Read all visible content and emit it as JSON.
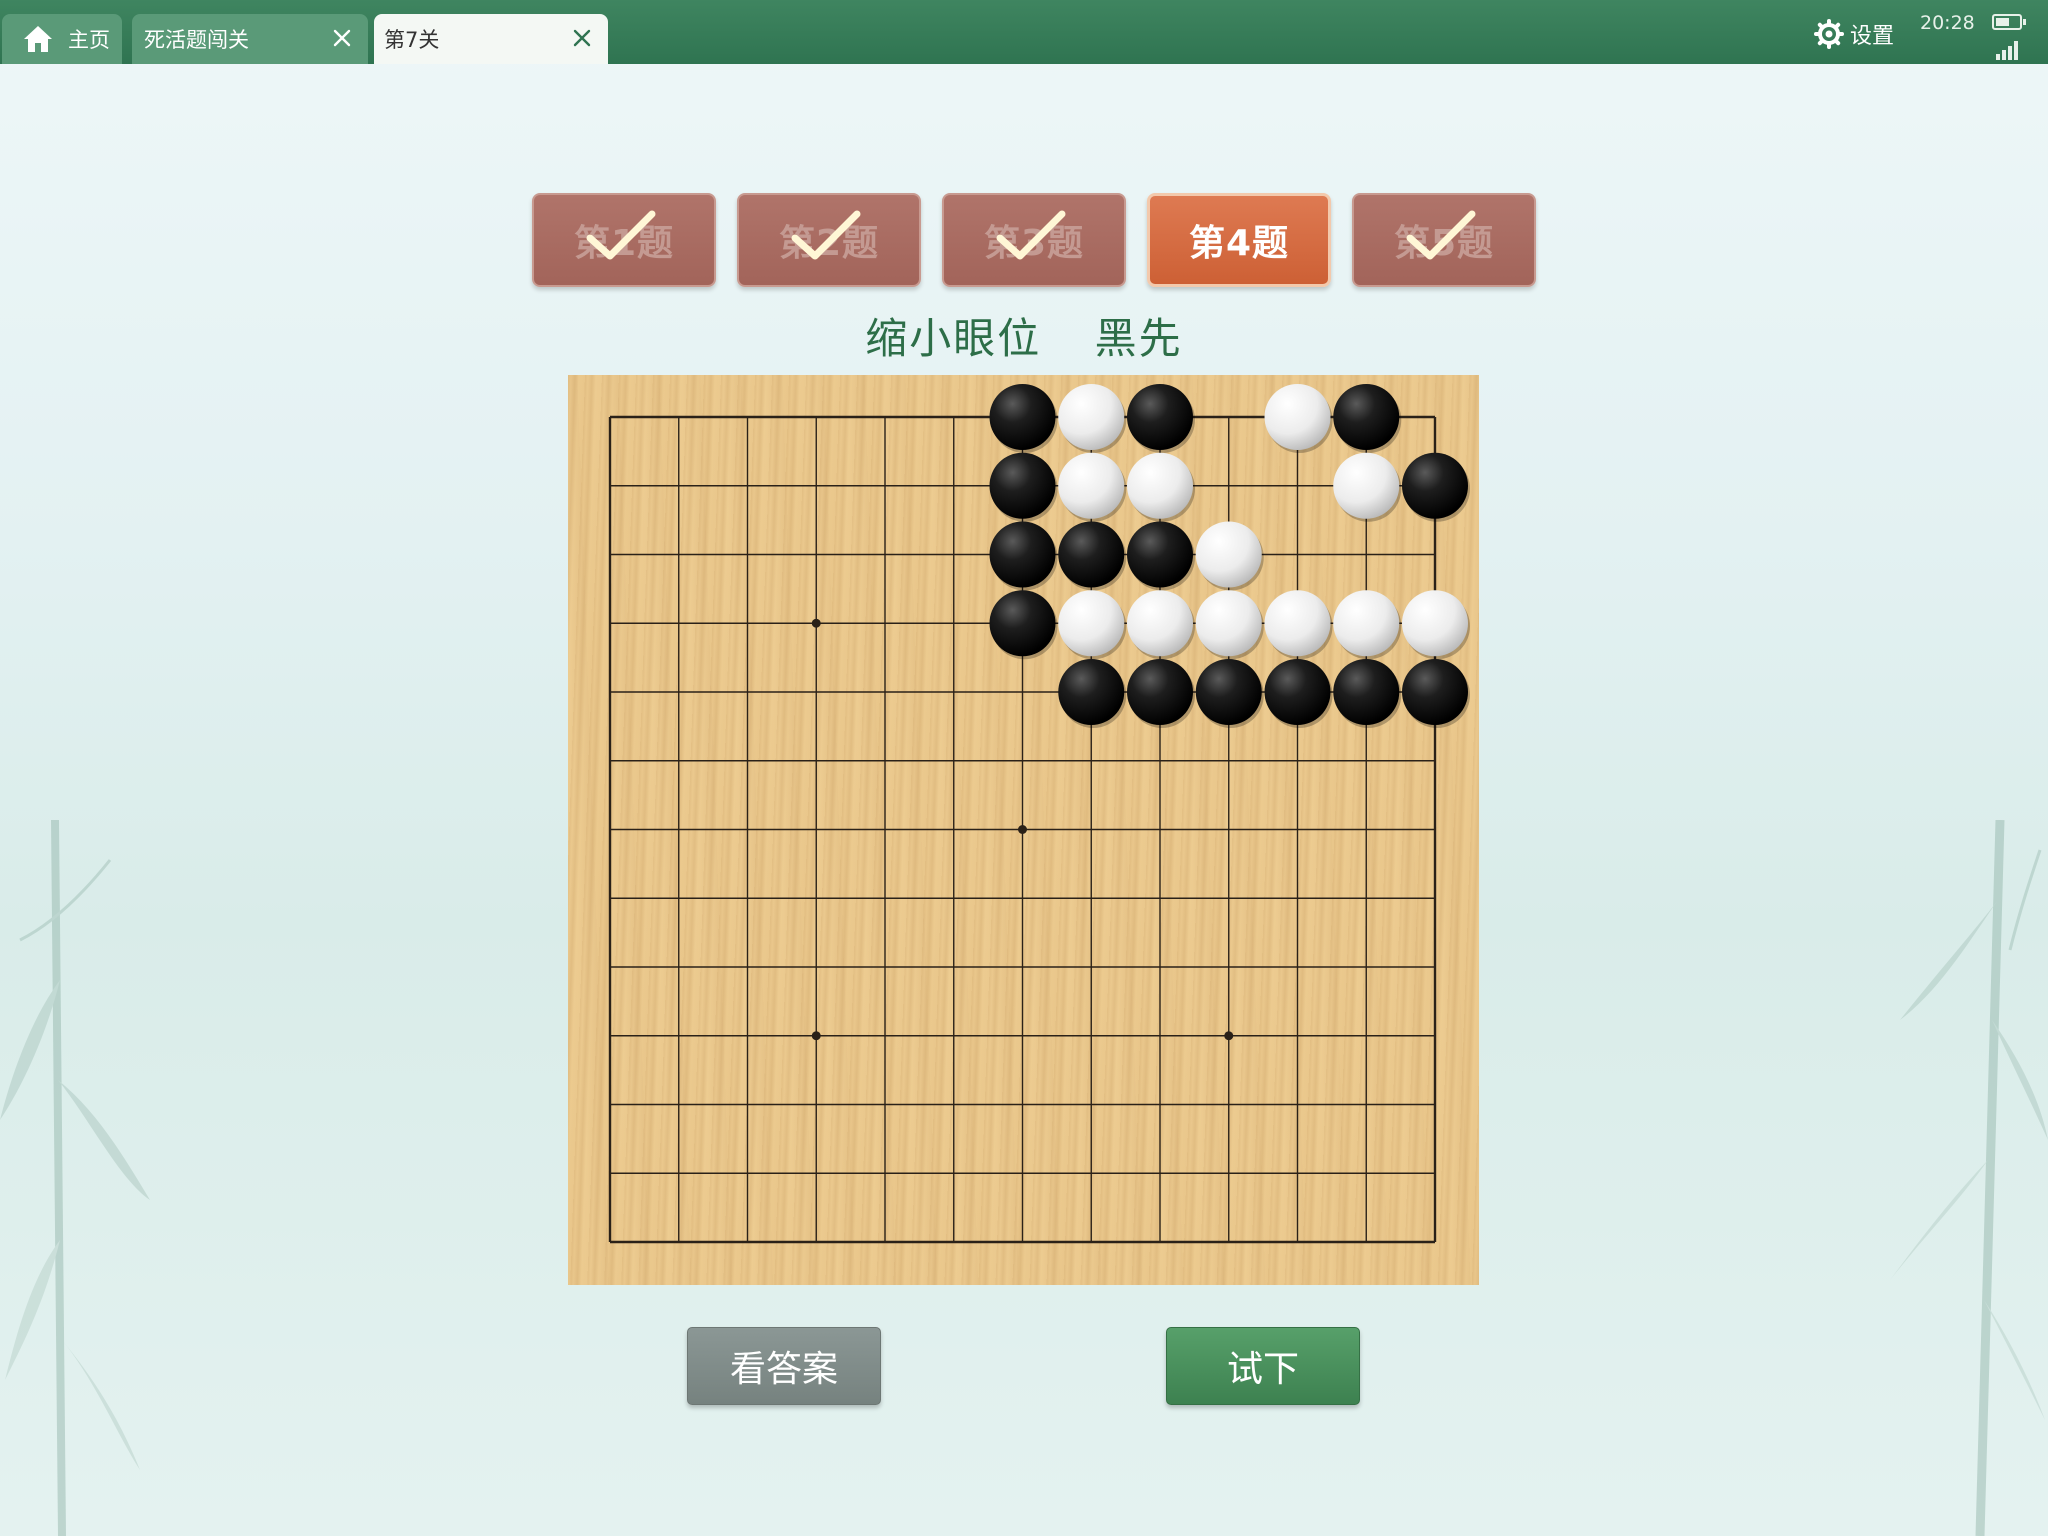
{
  "tabs": [
    {
      "label": "主页",
      "icon": "home-icon"
    },
    {
      "label": "死活题闯关",
      "closable": true
    },
    {
      "label": "第7关",
      "closable": true,
      "active": true
    }
  ],
  "status": {
    "settings_label": "设置",
    "time": "20:28",
    "battery_level": 0.6
  },
  "questions": [
    {
      "label": "第1题",
      "completed": true
    },
    {
      "label": "第2题",
      "completed": true
    },
    {
      "label": "第3题",
      "completed": true
    },
    {
      "label": "第4题",
      "completed": false,
      "active": true
    },
    {
      "label": "第5题",
      "completed": true
    }
  ],
  "problem": {
    "title": "缩小眼位",
    "turn": "黑先"
  },
  "board": {
    "size": 13,
    "star_points": [
      [
        3,
        3
      ],
      [
        6,
        6
      ],
      [
        3,
        9
      ],
      [
        9,
        9
      ]
    ],
    "stones": [
      {
        "col": 6,
        "row": 0,
        "color": "black"
      },
      {
        "col": 7,
        "row": 0,
        "color": "white"
      },
      {
        "col": 8,
        "row": 0,
        "color": "black"
      },
      {
        "col": 10,
        "row": 0,
        "color": "white"
      },
      {
        "col": 11,
        "row": 0,
        "color": "black"
      },
      {
        "col": 6,
        "row": 1,
        "color": "black"
      },
      {
        "col": 7,
        "row": 1,
        "color": "white"
      },
      {
        "col": 8,
        "row": 1,
        "color": "white"
      },
      {
        "col": 11,
        "row": 1,
        "color": "white"
      },
      {
        "col": 12,
        "row": 1,
        "color": "black"
      },
      {
        "col": 6,
        "row": 2,
        "color": "black"
      },
      {
        "col": 7,
        "row": 2,
        "color": "black"
      },
      {
        "col": 8,
        "row": 2,
        "color": "black"
      },
      {
        "col": 9,
        "row": 2,
        "color": "white"
      },
      {
        "col": 6,
        "row": 3,
        "color": "black"
      },
      {
        "col": 7,
        "row": 3,
        "color": "white"
      },
      {
        "col": 8,
        "row": 3,
        "color": "white"
      },
      {
        "col": 9,
        "row": 3,
        "color": "white"
      },
      {
        "col": 10,
        "row": 3,
        "color": "white"
      },
      {
        "col": 11,
        "row": 3,
        "color": "white"
      },
      {
        "col": 12,
        "row": 3,
        "color": "white"
      },
      {
        "col": 7,
        "row": 4,
        "color": "black"
      },
      {
        "col": 8,
        "row": 4,
        "color": "black"
      },
      {
        "col": 9,
        "row": 4,
        "color": "black"
      },
      {
        "col": 10,
        "row": 4,
        "color": "black"
      },
      {
        "col": 11,
        "row": 4,
        "color": "black"
      },
      {
        "col": 12,
        "row": 4,
        "color": "black"
      }
    ]
  },
  "actions": {
    "answer_label": "看答案",
    "try_label": "试下"
  },
  "colors": {
    "topbar": "#2f7451",
    "accent_active": "#cd6035",
    "completed_button": "#a2645a",
    "title_text": "#2d6e48",
    "board_wood": "#ebc98e"
  }
}
